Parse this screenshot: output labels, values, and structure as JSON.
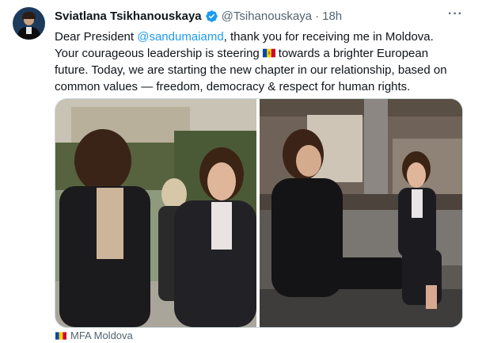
{
  "tweet": {
    "author_name": "Sviatlana Tsikhanouskaya",
    "handle": "@Tsihanouskaya",
    "separator": "·",
    "time": "18h",
    "more_label": "···",
    "text_part1": "Dear President ",
    "mention": "@sandumaiamd",
    "text_part2": ", thank you for receiving me in Moldova.\nYour courageous leadership is steering",
    "text_part3": "towards a brighter European\nfuture. Today, we are starting the new chapter in our relationship, based on\ncommon values — freedom, democracy & respect for human rights.",
    "source_label": "MFA Moldova"
  },
  "icons": {
    "verified": "verified-badge-icon",
    "more": "more-options-icon",
    "inline_flag": "moldova-flag-icon",
    "source_flag": "moldova-flag-icon"
  },
  "colors": {
    "accent": "#1d9bf0",
    "secondary_text": "#536471",
    "flag_blue": "#0046ae",
    "flag_yellow": "#ffd200",
    "flag_red": "#cc092f"
  }
}
